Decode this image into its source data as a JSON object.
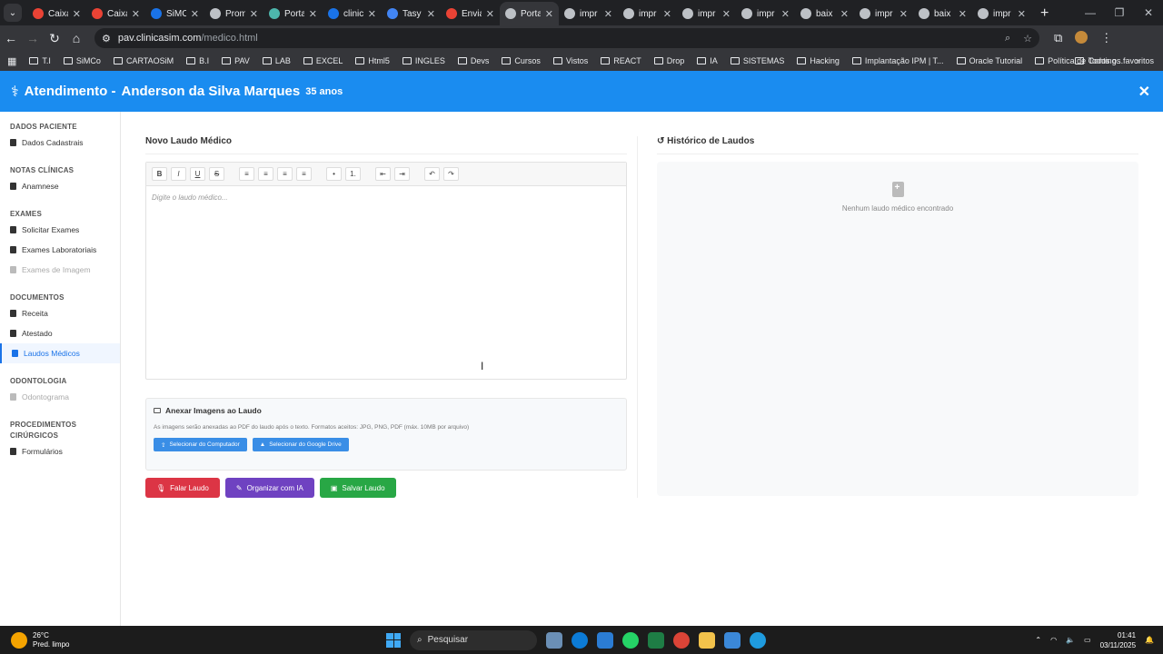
{
  "browser": {
    "tabs": [
      {
        "title": "Caixa",
        "icon": "gmail-icon",
        "color": "#ea4335"
      },
      {
        "title": "Caixa",
        "icon": "gmail-icon",
        "color": "#ea4335"
      },
      {
        "title": "SiMC",
        "icon": "doc-icon",
        "color": "#1a73e8"
      },
      {
        "title": "Prom",
        "icon": "globe-icon",
        "color": "#bdc1c6"
      },
      {
        "title": "Porta",
        "icon": "tag-icon",
        "color": "#4db6ac"
      },
      {
        "title": "clinic",
        "icon": "check-icon",
        "color": "#1a73e8"
      },
      {
        "title": "Tasy",
        "icon": "tasy-icon",
        "color": "#4285f4"
      },
      {
        "title": "Envia",
        "icon": "gmail-icon",
        "color": "#ea4335"
      },
      {
        "title": "Porta",
        "icon": "globe-icon",
        "color": "#bdc1c6"
      },
      {
        "title": "impr",
        "icon": "globe-icon",
        "color": "#bdc1c6"
      },
      {
        "title": "impr",
        "icon": "globe-icon",
        "color": "#bdc1c6"
      },
      {
        "title": "impr",
        "icon": "globe-icon",
        "color": "#bdc1c6"
      },
      {
        "title": "impr",
        "icon": "globe-icon",
        "color": "#bdc1c6"
      },
      {
        "title": "baix",
        "icon": "globe-icon",
        "color": "#bdc1c6"
      },
      {
        "title": "impr",
        "icon": "globe-icon",
        "color": "#bdc1c6"
      },
      {
        "title": "baix",
        "icon": "globe-icon",
        "color": "#bdc1c6"
      },
      {
        "title": "impr",
        "icon": "globe-icon",
        "color": "#bdc1c6"
      }
    ],
    "url_host": "pav.clinicasim.com",
    "url_path": "/medico.html",
    "bookmarks": [
      "T.I",
      "SiMCo",
      "CARTAOSiM",
      "B.I",
      "PAV",
      "LAB",
      "EXCEL",
      "Html5",
      "INGLES",
      "Devs",
      "Cursos",
      "Vistos",
      "REACT",
      "Drop",
      "IA",
      "SISTEMAS",
      "Hacking",
      "Implantação IPM | T...",
      "Oracle Tutorial",
      "Política de Conting..."
    ],
    "bookmarks_all": "Todos os favoritos"
  },
  "header": {
    "title": "Atendimento -",
    "patient": "Anderson da Silva Marques",
    "age": "35 anos"
  },
  "sidebar": {
    "sections": [
      {
        "label": "DADOS PACIENTE",
        "items": [
          {
            "label": "Dados Cadastrais",
            "state": "normal"
          }
        ]
      },
      {
        "label": "NOTAS CLÍNICAS",
        "items": [
          {
            "label": "Anamnese",
            "state": "normal"
          }
        ]
      },
      {
        "label": "EXAMES",
        "items": [
          {
            "label": "Solicitar Exames",
            "state": "normal"
          },
          {
            "label": "Exames Laboratoriais",
            "state": "normal"
          },
          {
            "label": "Exames de Imagem",
            "state": "disabled"
          }
        ]
      },
      {
        "label": "DOCUMENTOS",
        "items": [
          {
            "label": "Receita",
            "state": "normal"
          },
          {
            "label": "Atestado",
            "state": "normal"
          },
          {
            "label": "Laudos Médicos",
            "state": "active"
          }
        ]
      },
      {
        "label": "ODONTOLOGIA",
        "items": [
          {
            "label": "Odontograma",
            "state": "disabled"
          }
        ]
      },
      {
        "label": "PROCEDIMENTOS CIRÚRGICOS",
        "items": [
          {
            "label": "Formulários",
            "state": "normal"
          }
        ]
      }
    ]
  },
  "editor": {
    "title": "Novo Laudo Médico",
    "placeholder": "Digite o laudo médico...",
    "toolbar": [
      {
        "glyph": "B",
        "icon": "bold-icon"
      },
      {
        "glyph": "I",
        "icon": "italic-icon"
      },
      {
        "glyph": "U",
        "icon": "underline-icon"
      },
      {
        "glyph": "S",
        "icon": "strikethrough-icon"
      },
      {
        "glyph": "≡",
        "icon": "align-left-icon"
      },
      {
        "glyph": "≡",
        "icon": "align-center-icon"
      },
      {
        "glyph": "≡",
        "icon": "align-right-icon"
      },
      {
        "glyph": "≡",
        "icon": "align-justify-icon"
      },
      {
        "glyph": "•",
        "icon": "bullet-list-icon"
      },
      {
        "glyph": "1.",
        "icon": "numbered-list-icon"
      },
      {
        "glyph": "⇤",
        "icon": "outdent-icon"
      },
      {
        "glyph": "⇥",
        "icon": "indent-icon"
      },
      {
        "glyph": "↶",
        "icon": "undo-icon"
      },
      {
        "glyph": "↷",
        "icon": "redo-icon"
      }
    ]
  },
  "attach": {
    "title": "Anexar Imagens ao Laudo",
    "description": "As imagens serão anexadas ao PDF do laudo após o texto. Formatos aceitos: JPG, PNG, PDF (máx. 10MB por arquivo)",
    "btn_computer": "Selecionar do Computador",
    "btn_drive": "Selecionar do Google Drive"
  },
  "actions": {
    "speak": "Falar Laudo",
    "organize": "Organizar com IA",
    "save": "Salvar Laudo"
  },
  "history": {
    "title": "Histórico de Laudos",
    "empty": "Nenhum laudo médico encontrado"
  },
  "taskbar": {
    "temp": "26°C",
    "weather": "Pred. limpo",
    "search": "Pesquisar",
    "time": "01:41",
    "date": "03/11/2025"
  }
}
